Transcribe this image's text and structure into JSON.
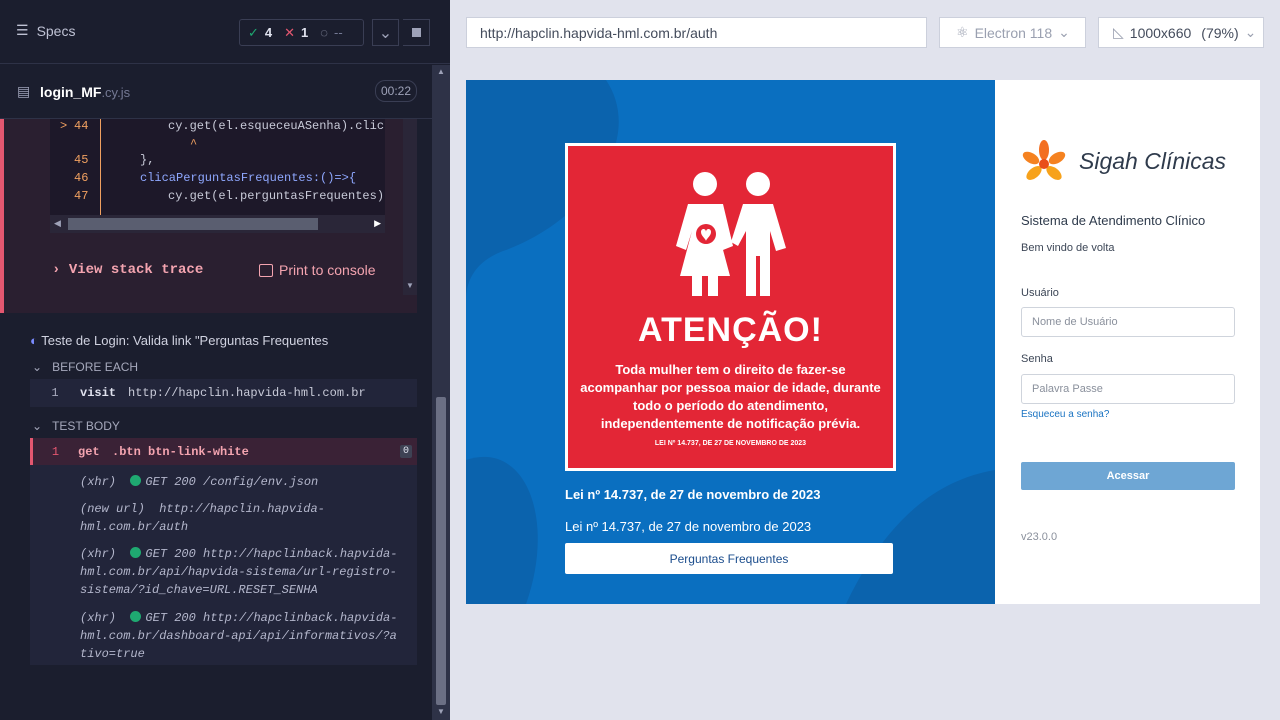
{
  "runner": {
    "specs_label": "Specs",
    "passed": "4",
    "failed": "1",
    "pending": "--",
    "file_name": "login_MF",
    "file_ext": ".cy.js",
    "duration": "00:22",
    "code_lines": [
      {
        "num": "44",
        "marker": ">",
        "text": "cy.get(el.esqueceuASenha).click"
      },
      {
        "num": "",
        "marker": "",
        "text": "^"
      },
      {
        "num": "45",
        "marker": "",
        "text": "},"
      },
      {
        "num": "46",
        "marker": "",
        "text": "clicaPerguntasFrequentes:()=>{"
      },
      {
        "num": "47",
        "marker": "",
        "text": "cy.get(el.perguntasFrequentes)"
      }
    ],
    "view_stack_trace": "View stack trace",
    "print_to_console": "Print to console",
    "test_title": "Teste de Login: Valida link \"Perguntas Frequentes",
    "before_each_label": "BEFORE EACH",
    "before_cmd": {
      "num": "1",
      "name": "visit",
      "arg": "http://hapclin.hapvida-hml.com.br"
    },
    "test_body_label": "TEST BODY",
    "body_cmd": {
      "num": "1",
      "name": "get",
      "arg": ".btn btn-link-white",
      "badge": "0"
    },
    "logs": [
      {
        "tag": "(xhr)",
        "text": "GET 200 /config/env.json",
        "dot": true
      },
      {
        "tag": "(new url)",
        "text": "http://hapclin.hapvida-hml.com.br/auth",
        "dot": false
      },
      {
        "tag": "(xhr)",
        "text": "GET 200 http://hapclinback.hapvida-hml.com.br/api/hapvida-sistema/url-registro-sistema/?id_chave=URL.RESET_SENHA",
        "dot": true
      },
      {
        "tag": "(xhr)",
        "text": "GET 200 http://hapclinback.hapvida-hml.com.br/dashboard-api/api/informativos/?ativo=true",
        "dot": true
      }
    ]
  },
  "browser": {
    "url": "http://hapclin.hapvida-hml.com.br/auth",
    "engine": "Electron 118",
    "viewport": "1000x660",
    "zoom": "(79%)"
  },
  "app": {
    "warning_title": "ATENÇÃO!",
    "warning_text": "Toda mulher tem o direito de fazer-se acompanhar por pessoa maior de idade, durante todo o período do atendimento, independentemente de notificação prévia.",
    "warning_law": "LEI Nº 14.737, DE 27 DE NOVEMBRO DE 2023",
    "law_bold": "Lei nº 14.737, de 27 de novembro de 2023",
    "law_plain": "Lei nº 14.737, de 27 de novembro de 2023",
    "faq_button": "Perguntas Frequentes",
    "brand": "Sigah Clínicas",
    "system": "Sistema de Atendimento Clínico",
    "welcome": "Bem vindo de volta",
    "user_label": "Usuário",
    "user_placeholder": "Nome de Usuário",
    "pass_label": "Senha",
    "pass_placeholder": "Palavra Passe",
    "forgot": "Esqueceu a senha?",
    "submit": "Acessar",
    "version": "v23.0.0"
  },
  "colors": {
    "accent_red": "#e32636",
    "brand_blue": "#0a6fc0",
    "pass_green": "#1fa971",
    "fail_red": "#e45770"
  }
}
